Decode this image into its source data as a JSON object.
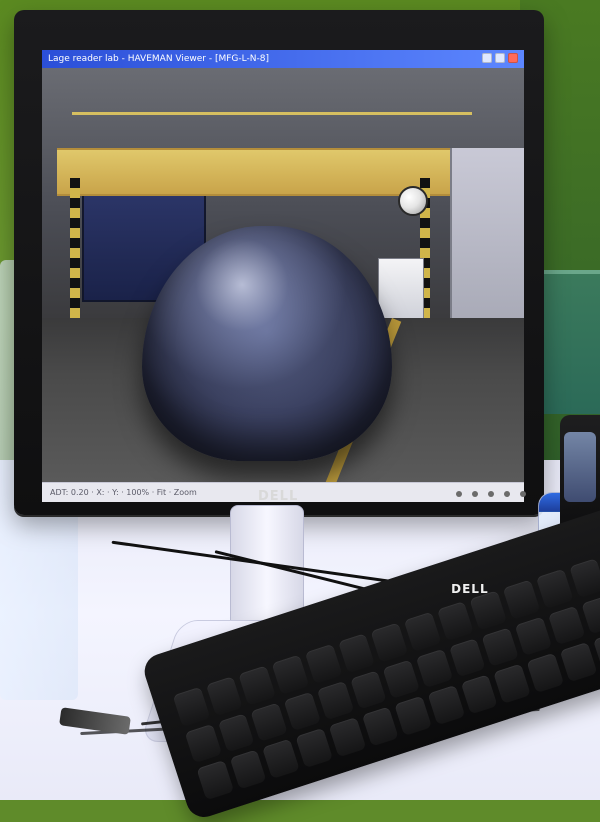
{
  "monitor": {
    "brand": "DELL",
    "window_title": "Lage reader lab - HAVEMAN Viewer - [MFG-L-N-8]",
    "statusbar_text": "ADT: 0.20  ·  X:  ·  Y:  ·  100%  ·  Fit  ·  Zoom"
  },
  "keyboard": {
    "brand": "DELL"
  },
  "colors": {
    "titlebar": "#2b4fd8",
    "titlebar_end": "#5d87ff",
    "jar_lid": "#2f6be2",
    "wall": "#5b8a21"
  },
  "icons": {
    "window_controls": [
      "minimize-icon",
      "maximize-icon",
      "close-icon"
    ]
  }
}
